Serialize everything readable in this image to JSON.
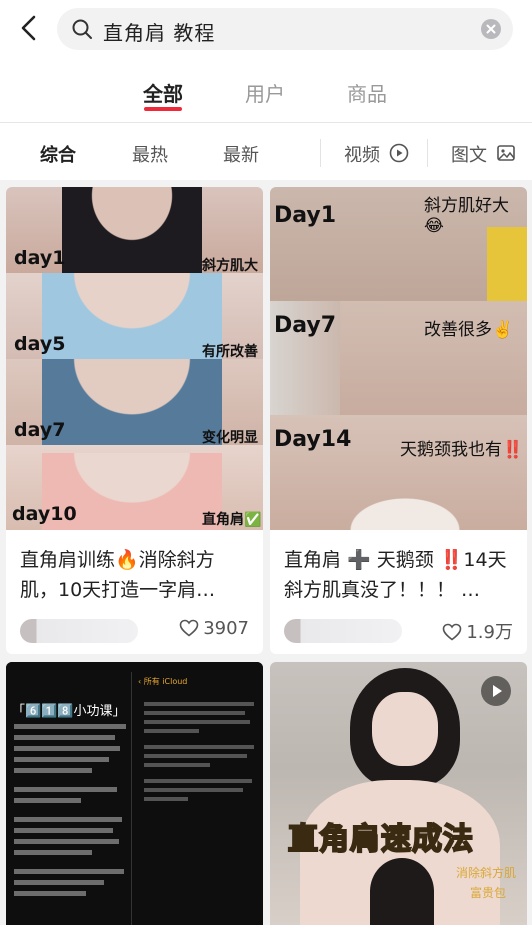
{
  "search": {
    "query": "直角肩 教程"
  },
  "tabs": [
    "全部",
    "用户",
    "商品"
  ],
  "filters": {
    "items": [
      "综合",
      "最热",
      "最新"
    ],
    "video": "视频",
    "image_text": "图文"
  },
  "cards": [
    {
      "title": "直角肩训练🔥消除斜方肌，10天打造一字肩…",
      "likes": "3907",
      "labels": [
        "day1",
        "day5",
        "day7",
        "day10"
      ],
      "notes": [
        "斜方肌大",
        "有所改善",
        "变化明显",
        "直角肩✅"
      ]
    },
    {
      "title": "直角肩 ➕ 天鹅颈 ‼️14天斜方肌真没了！！！ …",
      "likes": "1.9万",
      "labels": [
        "Day1",
        "Day7",
        "Day14"
      ],
      "notes": [
        "斜方肌好大😂",
        "改善很多✌️",
        "天鹅颈我也有‼️"
      ]
    },
    {
      "header": "「6️⃣1️⃣8️⃣小功课」",
      "right_header": "‹ 所有 iCloud"
    },
    {
      "overlay_title": "直角肩速成法",
      "overlay_sub": [
        "消除斜方肌",
        "富贵包"
      ]
    }
  ],
  "colors": {
    "accent": "#ee2a3a"
  }
}
